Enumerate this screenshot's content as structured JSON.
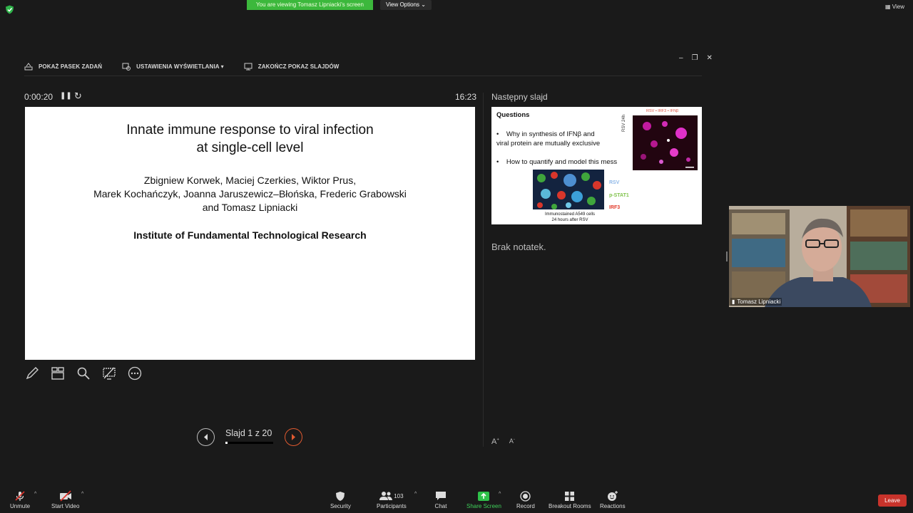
{
  "zoom_top": {
    "banner": "You are viewing Tomasz Lipniacki's screen",
    "view_options": "View Options",
    "view": "View"
  },
  "pp": {
    "toolbar": [
      {
        "label": "POKAŻ PASEK ZADAŃ"
      },
      {
        "label": "USTAWIENIA WYŚWIETLANIA ▾"
      },
      {
        "label": "ZAKOŃCZ POKAZ SLAJDÓW"
      }
    ],
    "timer": "0:00:20",
    "clock": "16:23",
    "next_label": "Następny slajd",
    "notes": "Brak notatek.",
    "slide_counter": "Slajd 1 z 20",
    "progress_fraction": 0.05
  },
  "slide": {
    "title_line1": "Innate immune response to viral infection",
    "title_line2": "at single-cell level",
    "authors_line1": "Zbigniew Korwek, Maciej Czerkies, Wiktor Prus,",
    "authors_line2": "Marek Kochańczyk, Joanna Jaruszewicz–Błońska, Frederic Grabowski",
    "authors_line3": "and Tomasz Lipniacki",
    "institute": "Institute of Fundamental Technological Research"
  },
  "next_slide": {
    "title": "Questions",
    "bullet1_line1": "Why in synthesis of IFNβ and",
    "bullet1_line2": "viral protein are mutually exclusive",
    "bullet2": "How to quantify and model this mess",
    "img_label": "RSV • IRF3 • IFNβ",
    "rsv24": "RSV 24h",
    "legend_rsv": "RSV",
    "legend_pstat": "p-STAT1",
    "legend_irf3": "IRF3",
    "caption_line1": "Immunostained A549 cells",
    "caption_line2": "24 hours after RSV",
    "colors": {
      "rsv": "#8fb8e8",
      "pstat": "#7fc24a",
      "irf3": "#e23b2b"
    }
  },
  "camera": {
    "name": "Tomasz Lipniacki"
  },
  "bottom_bar": {
    "unmute": "Unmute",
    "start_video": "Start Video",
    "security": "Security",
    "participants": "Participants",
    "participants_count": "103",
    "chat": "Chat",
    "share_screen": "Share Screen",
    "record": "Record",
    "breakout": "Breakout Rooms",
    "reactions": "Reactions",
    "leave": "Leave"
  }
}
